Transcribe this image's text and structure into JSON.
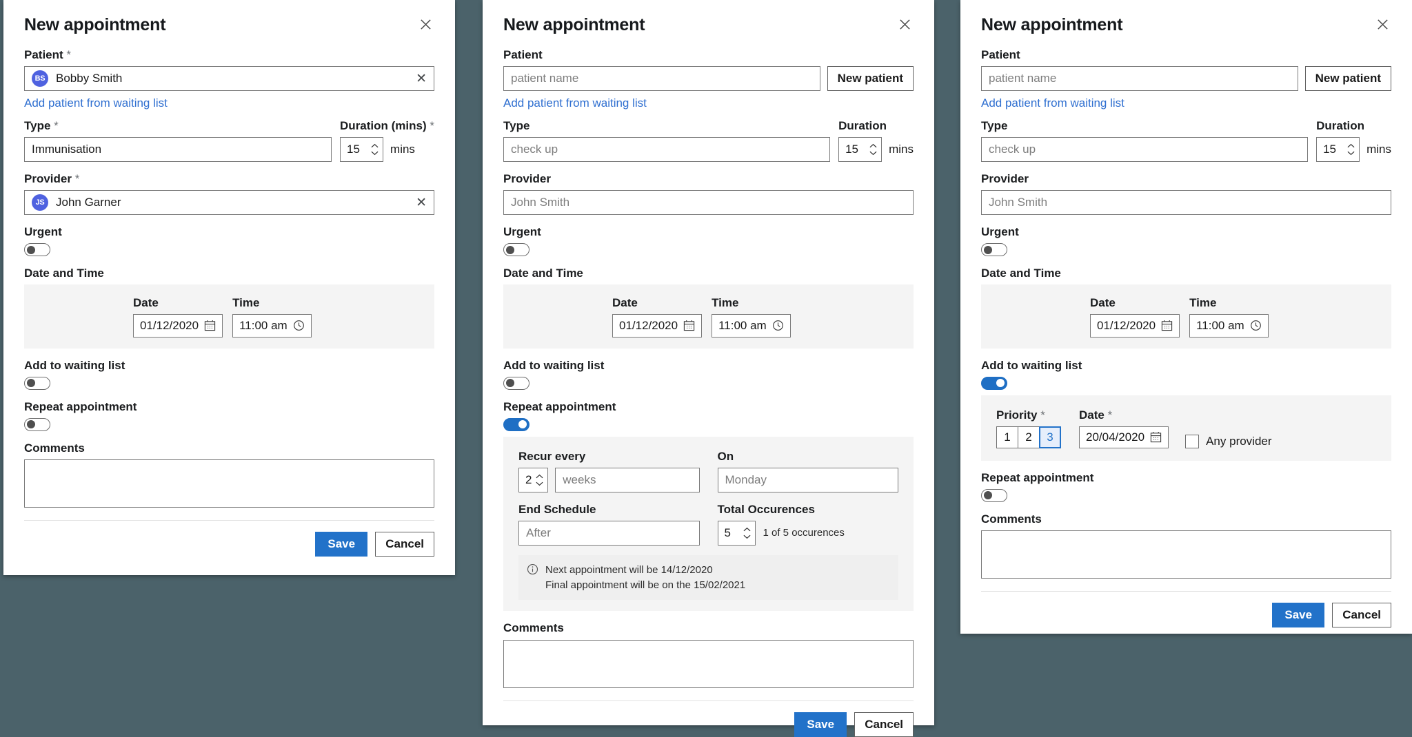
{
  "background_color": "#4b626a",
  "accent_color": "#2272c9",
  "link_color": "#2f6fd0",
  "avatar_color": "#4f62e0",
  "common": {
    "title": "New appointment",
    "close_icon": "close-icon",
    "patient_label": "Patient",
    "type_label": "Type",
    "provider_label": "Provider",
    "urgent_label": "Urgent",
    "date_and_time_label": "Date and Time",
    "date_label": "Date",
    "time_label": "Time",
    "add_to_waiting_list_label": "Add to waiting list",
    "repeat_appointment_label": "Repeat appointment",
    "comments_label": "Comments",
    "save_label": "Save",
    "cancel_label": "Cancel",
    "add_patient_link": "Add patient from waiting list",
    "new_patient_label": "New patient",
    "mins_label": "mins",
    "required_marker": "*",
    "date_value": "01/12/2020",
    "time_value": "11:00 am"
  },
  "panel1": {
    "title": "New appointment",
    "patient_label": "Patient",
    "patient_value": "Bobby Smith",
    "patient_initials": "BS",
    "add_patient_link": "Add patient from waiting list",
    "type_label": "Type",
    "type_value": "Immunisation",
    "duration_label": "Duration (mins)",
    "duration_value": "15",
    "mins_label": "mins",
    "provider_label": "Provider",
    "provider_value": "John Garner",
    "provider_initials": "JS",
    "urgent_label": "Urgent",
    "urgent_on": false,
    "date_and_time_label": "Date and Time",
    "date_label": "Date",
    "date_value": "01/12/2020",
    "time_label": "Time",
    "time_value": "11:00 am",
    "add_to_waiting_list_label": "Add to waiting list",
    "waiting_list_on": false,
    "repeat_appointment_label": "Repeat appointment",
    "repeat_on": false,
    "comments_label": "Comments",
    "comments_value": "",
    "save_label": "Save",
    "cancel_label": "Cancel"
  },
  "panel2": {
    "title": "New appointment",
    "patient_label": "Patient",
    "patient_placeholder": "patient name",
    "new_patient_label": "New patient",
    "add_patient_link": "Add patient from waiting list",
    "type_label": "Type",
    "type_placeholder": "check up",
    "duration_label": "Duration",
    "duration_value": "15",
    "mins_label": "mins",
    "provider_label": "Provider",
    "provider_placeholder": "John Smith",
    "urgent_label": "Urgent",
    "urgent_on": false,
    "date_and_time_label": "Date and Time",
    "date_label": "Date",
    "date_value": "01/12/2020",
    "time_label": "Time",
    "time_value": "11:00 am",
    "add_to_waiting_list_label": "Add to waiting list",
    "waiting_list_on": false,
    "repeat_appointment_label": "Repeat appointment",
    "repeat_on": true,
    "recur_every_label": "Recur every",
    "recur_every_value": "2",
    "recur_unit_placeholder": "weeks",
    "on_label": "On",
    "on_placeholder": "Monday",
    "end_schedule_label": "End Schedule",
    "end_schedule_placeholder": "After",
    "total_occurrences_label": "Total Occurences",
    "total_occurrences_value": "5",
    "occurrences_note": "1 of 5 occurences",
    "info_line_1": "Next appointment will be 14/12/2020",
    "info_line_2": "Final appointment will be on the 15/02/2021",
    "comments_label": "Comments",
    "comments_value": "",
    "save_label": "Save",
    "cancel_label": "Cancel"
  },
  "panel3": {
    "title": "New appointment",
    "patient_label": "Patient",
    "patient_placeholder": "patient name",
    "new_patient_label": "New patient",
    "add_patient_link": "Add patient from waiting list",
    "type_label": "Type",
    "type_placeholder": "check up",
    "duration_label": "Duration",
    "duration_value": "15",
    "mins_label": "mins",
    "provider_label": "Provider",
    "provider_placeholder": "John Smith",
    "urgent_label": "Urgent",
    "urgent_on": false,
    "date_and_time_label": "Date and Time",
    "date_label": "Date",
    "date_value": "01/12/2020",
    "time_label": "Time",
    "time_value": "11:00 am",
    "add_to_waiting_list_label": "Add to waiting list",
    "waiting_list_on": true,
    "priority_label": "Priority",
    "priority_options": [
      "1",
      "2",
      "3"
    ],
    "priority_selected": "3",
    "wl_date_label": "Date",
    "wl_date_value": "20/04/2020",
    "any_provider_label": "Any provider",
    "any_provider_checked": false,
    "repeat_appointment_label": "Repeat appointment",
    "repeat_on": false,
    "comments_label": "Comments",
    "comments_value": "",
    "save_label": "Save",
    "cancel_label": "Cancel"
  }
}
